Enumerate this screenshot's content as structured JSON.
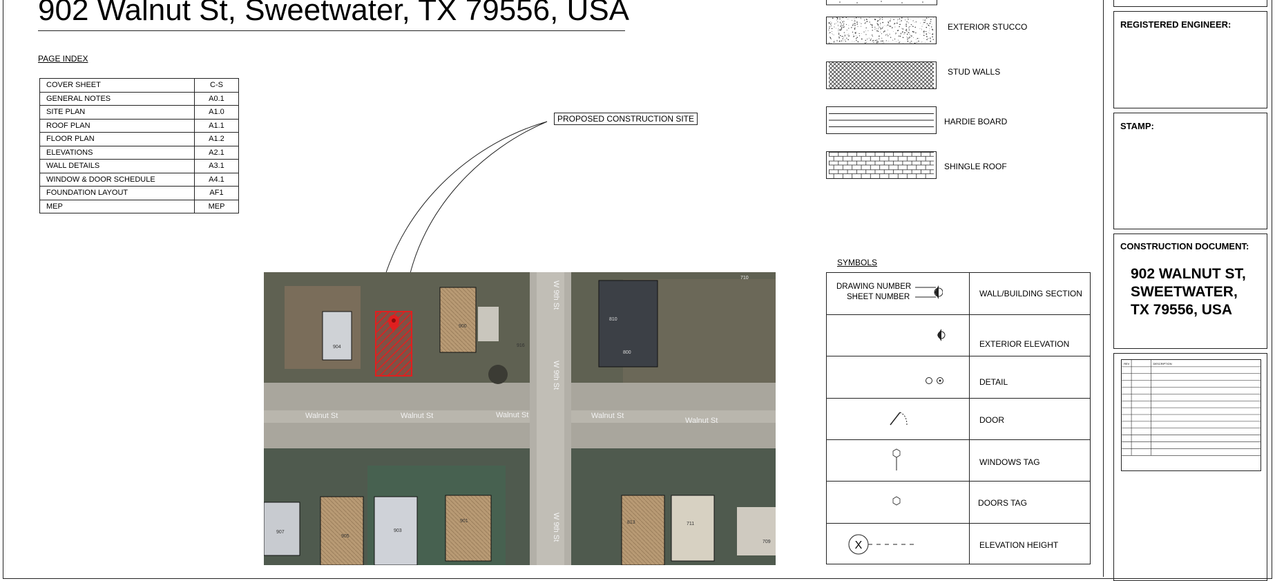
{
  "title": "902 Walnut St, Sweetwater, TX 79556, USA",
  "page_index": {
    "label": "PAGE INDEX",
    "rows": [
      {
        "name": "COVER SHEET",
        "sheet": "C-S"
      },
      {
        "name": "GENERAL NOTES",
        "sheet": "A0.1"
      },
      {
        "name": "SITE PLAN",
        "sheet": "A1.0"
      },
      {
        "name": "ROOF PLAN",
        "sheet": "A1.1"
      },
      {
        "name": "FLOOR PLAN",
        "sheet": "A1.2"
      },
      {
        "name": "ELEVATIONS",
        "sheet": "A2.1"
      },
      {
        "name": "WALL DETAILS",
        "sheet": "A3.1"
      },
      {
        "name": "WINDOW & DOOR SCHEDULE",
        "sheet": "A4.1"
      },
      {
        "name": "FOUNDATION LAYOUT",
        "sheet": "AF1"
      },
      {
        "name": "MEP",
        "sheet": "MEP"
      }
    ]
  },
  "callout": "PROPOSED CONSTRUCTION SITE",
  "map": {
    "street_labels": [
      "Walnut St",
      "Walnut St",
      "Walnut St",
      "Walnut St",
      "Walnut St"
    ],
    "cross_street_labels": [
      "W 9th St",
      "W 9th St",
      "W 9th St"
    ],
    "house_numbers": [
      "904",
      "900",
      "916",
      "810",
      "800",
      "710",
      "907",
      "905",
      "903",
      "901",
      "813",
      "711",
      "709"
    ],
    "highlight_color": "#e01f1f"
  },
  "materials": [
    {
      "label": "EXTERIOR STUCCO",
      "pattern": "stucco"
    },
    {
      "label": "STUD WALLS",
      "pattern": "crosshatch"
    },
    {
      "label": "HARDIE BOARD",
      "pattern": "lines"
    },
    {
      "label": "SHINGLE ROOF",
      "pattern": "shingle"
    }
  ],
  "symbols": {
    "label": "SYMBOLS",
    "drawing_number": "DRAWING NUMBER",
    "sheet_number": "SHEET NUMBER",
    "elevation_mark": "X",
    "rows": [
      {
        "label": "WALL/BUILDING SECTION",
        "icon": "section-marker-icon"
      },
      {
        "label": "EXTERIOR ELEVATION",
        "icon": "elevation-marker-icon"
      },
      {
        "label": "DETAIL",
        "icon": "detail-marker-icon"
      },
      {
        "label": "DOOR",
        "icon": "door-swing-icon"
      },
      {
        "label": "WINDOWS TAG",
        "icon": "window-tag-icon"
      },
      {
        "label": "DOORS TAG",
        "icon": "door-tag-icon"
      },
      {
        "label": "ELEVATION HEIGHT",
        "icon": "elevation-height-icon"
      }
    ]
  },
  "title_block": {
    "engineer_label": "REGISTERED ENGINEER:",
    "stamp_label": "STAMP:",
    "construction_label": "CONSTRUCTION DOCUMENT:",
    "address_lines": [
      "902 WALNUT ST,",
      "SWEETWATER,",
      "TX 79556, USA"
    ],
    "revision_headers": [
      "REV",
      "",
      "DESCRIPTION"
    ]
  }
}
